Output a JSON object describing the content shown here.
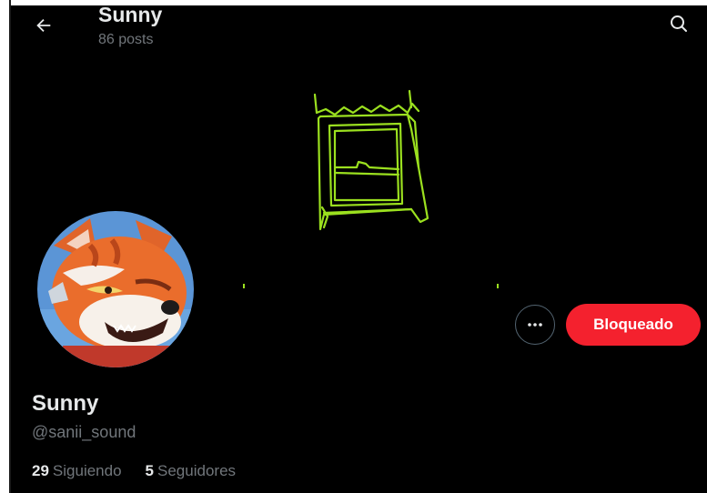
{
  "header": {
    "title": "Sunny",
    "posts": "86 posts",
    "back_icon": "arrow-left-icon",
    "search_icon": "search-icon"
  },
  "banner": {
    "description_icon": "hand-drawn-window-doodle",
    "stroke_color": "#9be01f"
  },
  "profile": {
    "display_name": "Sunny",
    "handle": "@sanii_sound",
    "avatar_icon": "fox-character-avatar"
  },
  "actions": {
    "more_icon": "more-horizontal-icon",
    "blocked_label": "Bloqueado",
    "blocked_color": "#f4212e"
  },
  "stats": {
    "following_count": "29",
    "following_label": "Siguiendo",
    "followers_count": "5",
    "followers_label": "Seguidores"
  },
  "colors": {
    "background": "#000000",
    "text_primary": "#e7e9ea",
    "text_secondary": "#71767b"
  }
}
